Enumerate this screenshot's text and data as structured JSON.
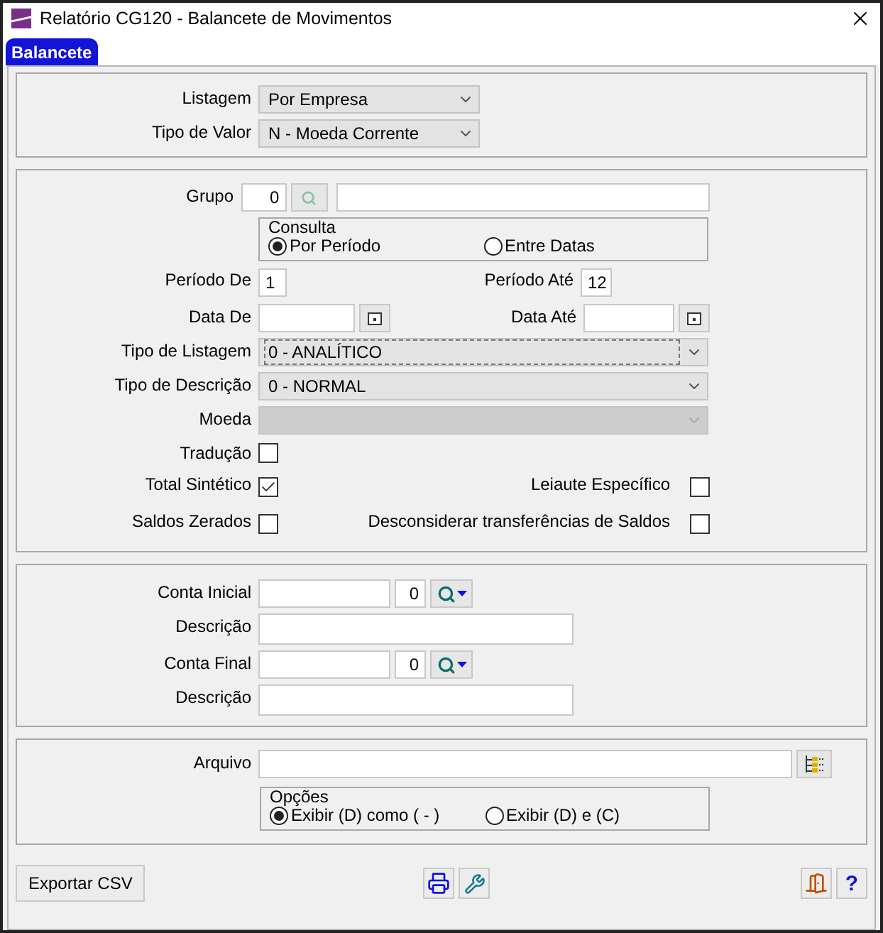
{
  "window": {
    "title": "Relatório CG120 - Balancete de Movimentos"
  },
  "tabs": [
    {
      "label": "Balancete",
      "selected": true
    }
  ],
  "listing": {
    "listagem": {
      "label": "Listagem",
      "value": "Por Empresa"
    },
    "tipo_valor": {
      "label": "Tipo de Valor",
      "value": "N - Moeda Corrente"
    }
  },
  "filters": {
    "grupo": {
      "label": "Grupo",
      "code": "0"
    },
    "consulta": {
      "title": "Consulta",
      "options": [
        {
          "label": "Por Período",
          "selected": true
        },
        {
          "label": "Entre Datas",
          "selected": false
        }
      ]
    },
    "periodo_de": {
      "label": "Período De",
      "value": "1"
    },
    "periodo_ate": {
      "label": "Período Até",
      "value": "12"
    },
    "data_de": {
      "label": "Data De"
    },
    "data_ate": {
      "label": "Data Até"
    },
    "selects": [
      {
        "label": "Tipo de Listagem",
        "value": "0 - ANALÍTICO",
        "focused": true,
        "disabled": false
      },
      {
        "label": "Tipo de Descrição",
        "value": "0 - NORMAL",
        "focused": false,
        "disabled": false
      },
      {
        "label": "Moeda",
        "focused": false,
        "disabled": true
      }
    ],
    "traducao": {
      "label": "Tradução",
      "checked": false
    },
    "total_sintetico": {
      "label": "Total Sintético",
      "checked": true
    },
    "leiaute": {
      "label": "Leiaute Específico",
      "checked": false
    },
    "saldos_zerados": {
      "label": "Saldos Zerados",
      "checked": false
    },
    "desconsiderar": {
      "label": "Desconsiderar transferências de Saldos",
      "checked": false
    }
  },
  "contas": [
    {
      "label": "Conta Inicial",
      "code": "0",
      "description_label": "Descrição"
    },
    {
      "label": "Conta Final",
      "code": "0",
      "description_label": "Descrição"
    }
  ],
  "output": {
    "arquivo": {
      "label": "Arquivo"
    },
    "opcoes": {
      "title": "Opções",
      "options": [
        {
          "label": "Exibir (D) como ( - )",
          "selected": true
        },
        {
          "label": "Exibir (D) e (C)",
          "selected": false
        }
      ]
    }
  },
  "footer": {
    "export": "Exportar CSV",
    "help": "?"
  }
}
